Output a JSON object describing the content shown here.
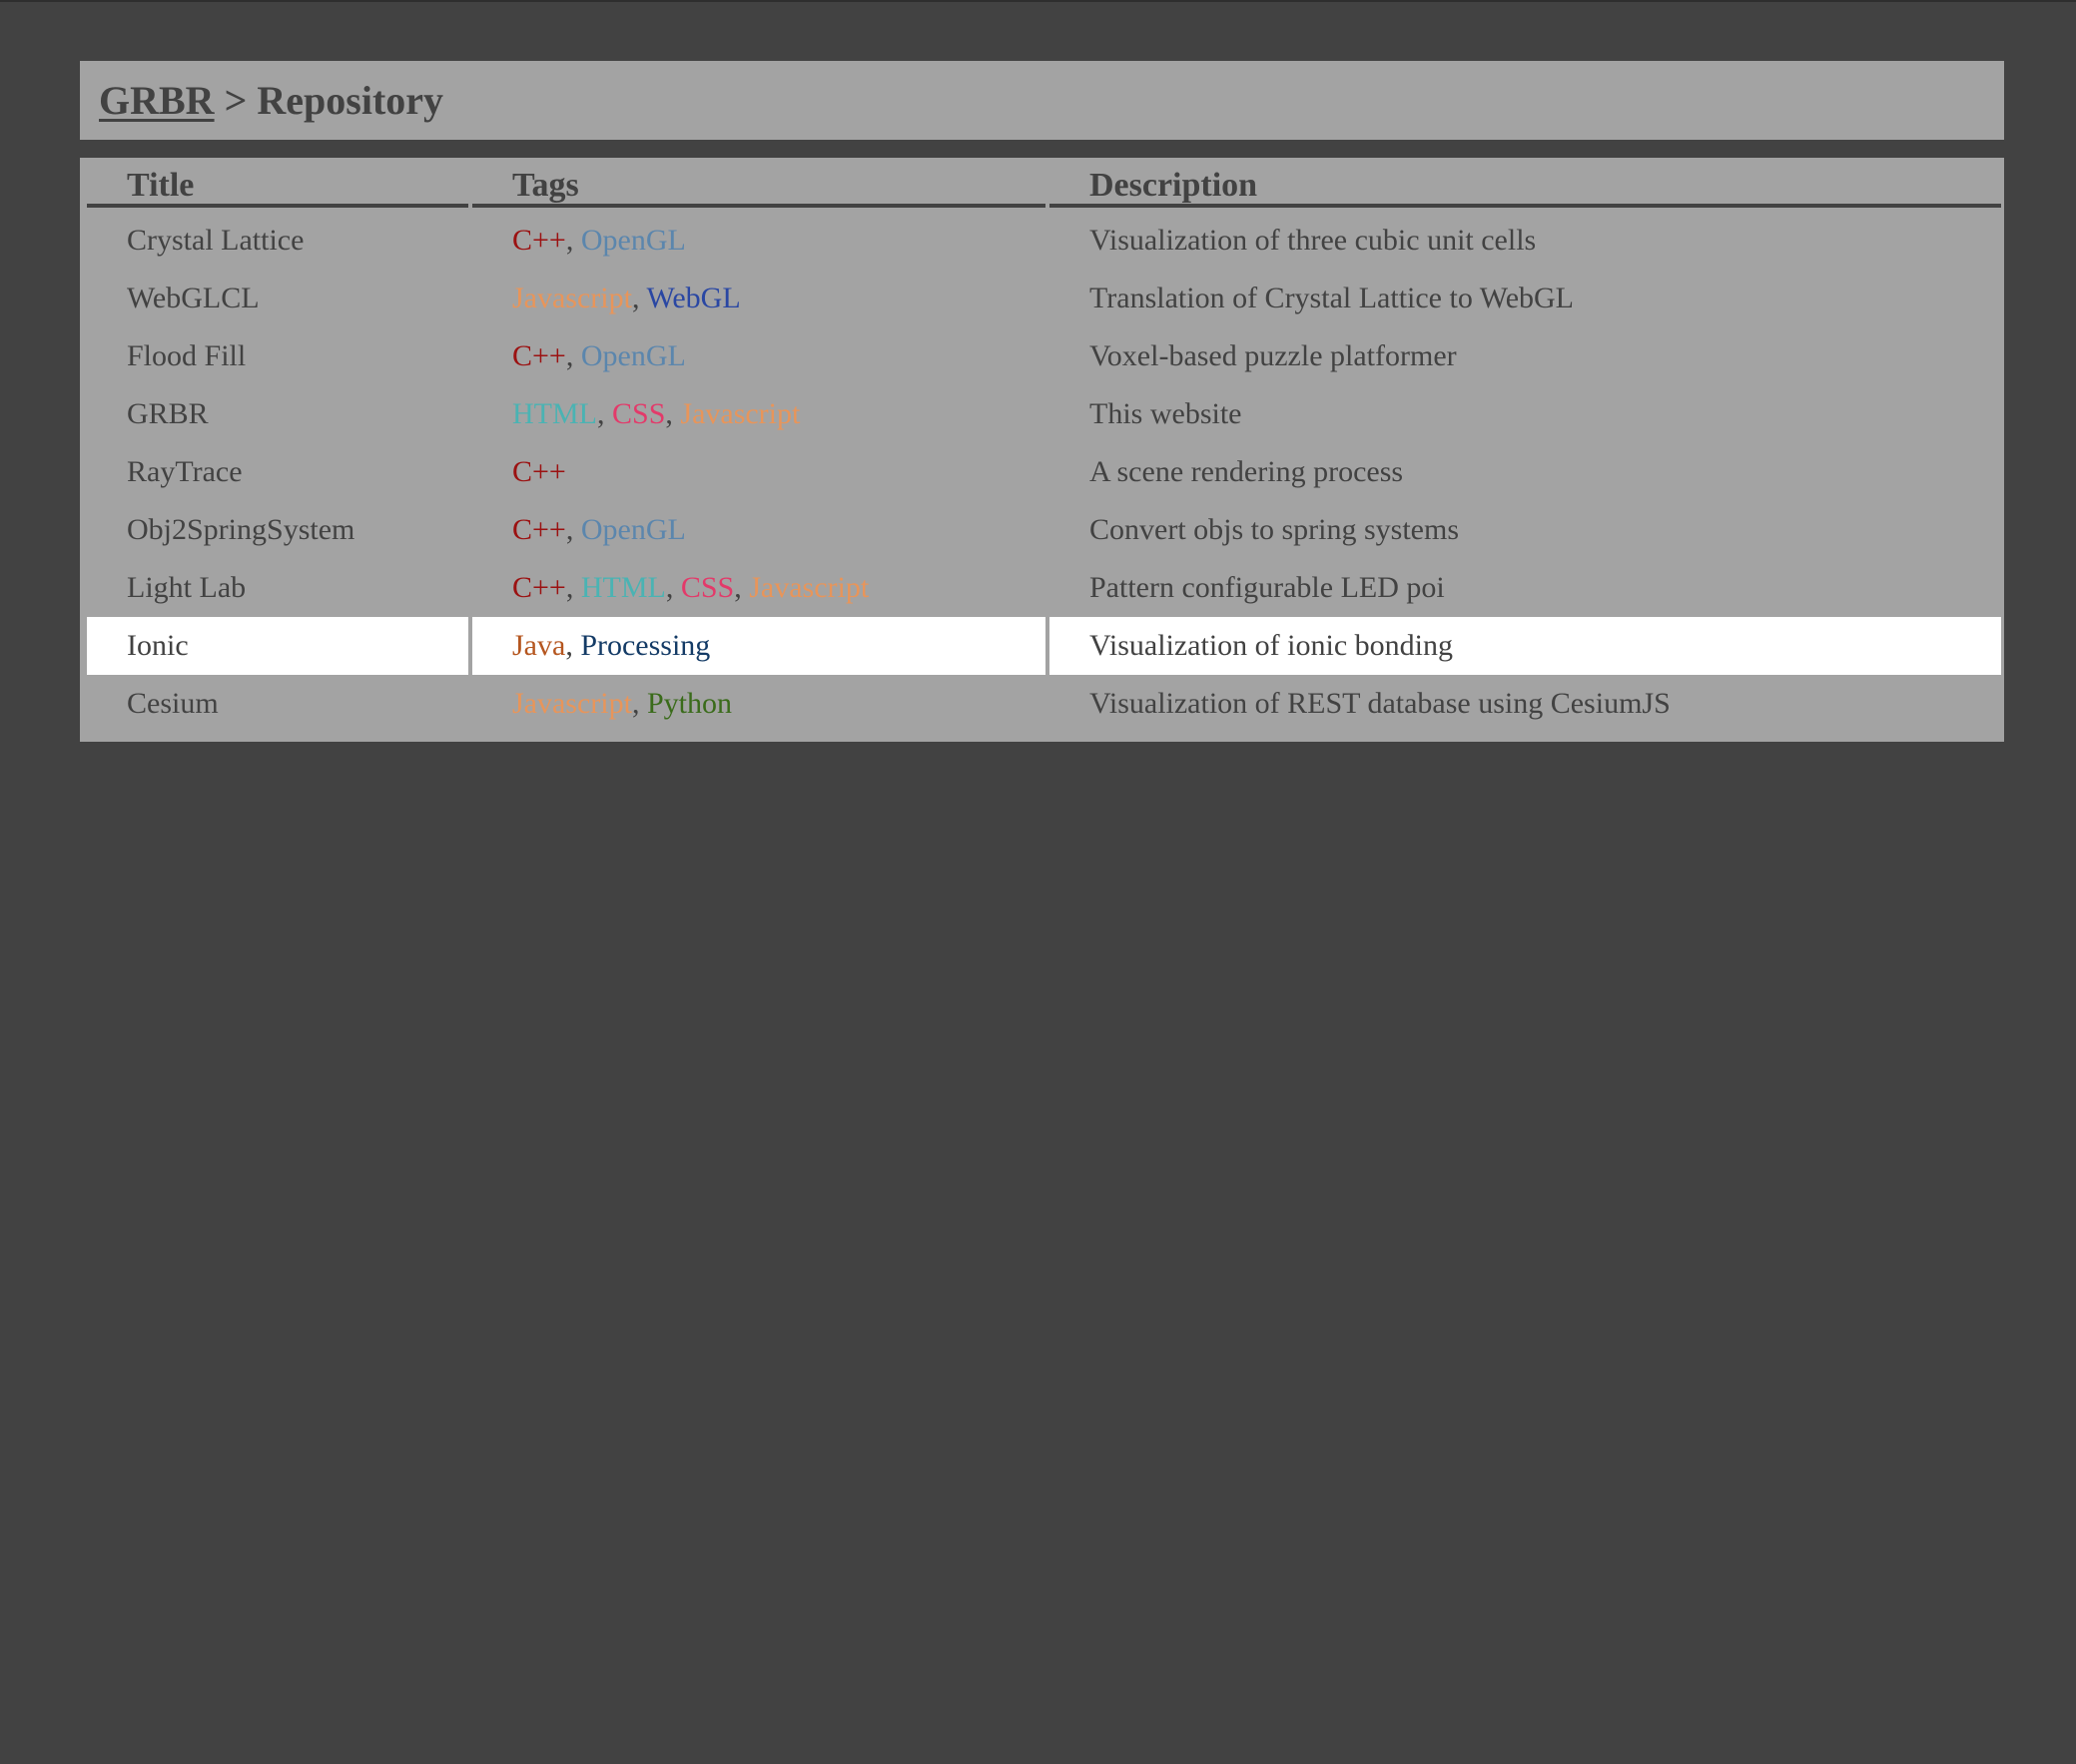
{
  "header": {
    "site_link": "GRBR",
    "separator": " > ",
    "page_title": "Repository"
  },
  "table": {
    "columns": [
      "Title",
      "Tags",
      "Description"
    ],
    "rows": [
      {
        "title": "Crystal Lattice",
        "tags": [
          {
            "name": "C++",
            "color": "#9b1111"
          },
          {
            "name": "OpenGL",
            "color": "#5b86ad"
          }
        ],
        "description": "Visualization of three cubic unit cells"
      },
      {
        "title": "WebGLCL",
        "tags": [
          {
            "name": "Javascript",
            "color": "#e8955a"
          },
          {
            "name": "WebGL",
            "color": "#2a47a3"
          }
        ],
        "description": "Translation of Crystal Lattice to WebGL"
      },
      {
        "title": "Flood Fill",
        "tags": [
          {
            "name": "C++",
            "color": "#9b1111"
          },
          {
            "name": "OpenGL",
            "color": "#5b86ad"
          }
        ],
        "description": "Voxel-based puzzle platformer"
      },
      {
        "title": "GRBR",
        "tags": [
          {
            "name": "HTML",
            "color": "#4ab3b3"
          },
          {
            "name": "CSS",
            "color": "#e33a6a"
          },
          {
            "name": "Javascript",
            "color": "#e8955a"
          }
        ],
        "description": "This website"
      },
      {
        "title": "RayTrace",
        "tags": [
          {
            "name": "C++",
            "color": "#9b1111"
          }
        ],
        "description": "A scene rendering process"
      },
      {
        "title": "Obj2SpringSystem",
        "tags": [
          {
            "name": "C++",
            "color": "#9b1111"
          },
          {
            "name": "OpenGL",
            "color": "#5b86ad"
          }
        ],
        "description": "Convert objs to spring systems"
      },
      {
        "title": "Light Lab",
        "tags": [
          {
            "name": "C++",
            "color": "#9b1111"
          },
          {
            "name": "HTML",
            "color": "#4ab3b3"
          },
          {
            "name": "CSS",
            "color": "#e33a6a"
          },
          {
            "name": "Javascript",
            "color": "#e8955a"
          }
        ],
        "description": "Pattern configurable LED poi"
      },
      {
        "title": "Ionic",
        "highlighted": true,
        "tags": [
          {
            "name": "Java",
            "color": "#b5561f"
          },
          {
            "name": "Processing",
            "color": "#143b66"
          }
        ],
        "description": "Visualization of ionic bonding"
      },
      {
        "title": "Cesium",
        "tags": [
          {
            "name": "Javascript",
            "color": "#e8955a"
          },
          {
            "name": "Python",
            "color": "#3a6b1a"
          }
        ],
        "description": "Visualization of REST database using CesiumJS"
      }
    ]
  },
  "colors": {
    "page_background": "#424242",
    "panel_background": "#a3a3a3",
    "text": "#424242",
    "highlight_row": "#ffffff"
  }
}
